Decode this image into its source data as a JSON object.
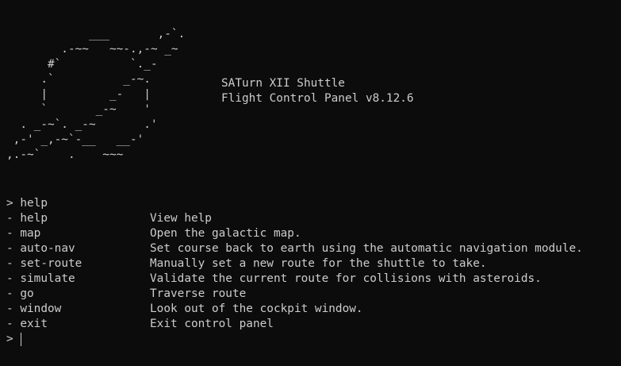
{
  "ascii_art": "            ___       ,-`.\n        .-~~   ~~-.,-~ _~\n      #`          `._-\n     .`          _-~.\n     |         _-   |\n     `       _-~    '\n  . _-~`. _-~       .'\n ,-' _,-~`-__   __-'\n,.-~`    .    ~~~",
  "banner": {
    "title": "SATurn XII Shuttle",
    "subtitle": "Flight Control Panel v8.12.6"
  },
  "prompt_symbol": ">",
  "history_command": "help",
  "bullet": "-",
  "commands": [
    {
      "name": "help",
      "description": "View help"
    },
    {
      "name": "map",
      "description": "Open the galactic map."
    },
    {
      "name": "auto-nav",
      "description": "Set course back to earth using the automatic navigation module."
    },
    {
      "name": "set-route",
      "description": "Manually set a new route for the shuttle to take."
    },
    {
      "name": "simulate",
      "description": "Validate the current route for collisions with asteroids."
    },
    {
      "name": "go",
      "description": "Traverse route"
    },
    {
      "name": "window",
      "description": "Look out of the cockpit window."
    },
    {
      "name": "exit",
      "description": "Exit control panel"
    }
  ],
  "current_input": ""
}
